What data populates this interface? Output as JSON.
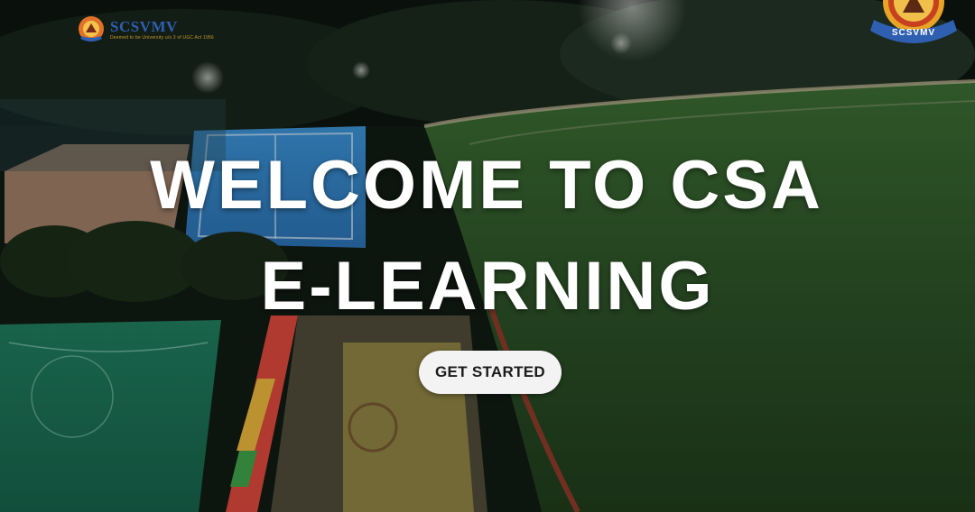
{
  "header": {
    "logo_left": {
      "icon": "university-emblem-icon",
      "brand": "SCSVMV",
      "tagline": "Deemed to be University u/s 3 of UGC Act 1956"
    },
    "logo_right": {
      "icon": "university-seal-icon",
      "text": "SCSVMV"
    }
  },
  "hero": {
    "title_line1": "WELCOME TO CSA",
    "title_line2": "E-LEARNING",
    "cta_label": "GET STARTED",
    "background": "campus-sports-ground-night-aerial"
  },
  "colors": {
    "title": "#ffffff",
    "cta_bg": "#f3f3f3",
    "cta_text": "#1b1b1b",
    "brand_blue": "#2f5fb0",
    "brand_gold": "#c89a2a",
    "turf_green": "#2f5a2c"
  }
}
